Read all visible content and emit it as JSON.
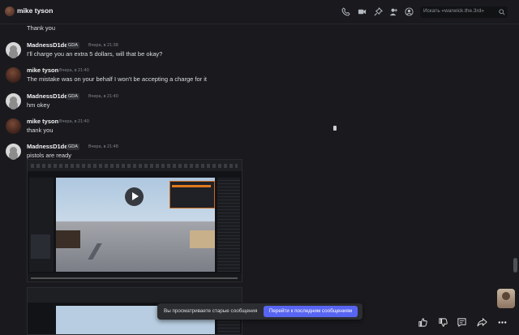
{
  "header": {
    "title": "mike tyson",
    "search_placeholder": "Искать «warwick.the.3rd»"
  },
  "messages": {
    "cont_text": "Thank you",
    "m1": {
      "author": "MadnessD1de",
      "tag": "GDA",
      "time": "Вчера, в 21:38",
      "text": "I'll charge you an extra 5 dollars, will that be okay?"
    },
    "m2": {
      "author": "mike tyson",
      "time": "Вчера, в 21:40",
      "text": "The mistake was on your behalf I won't be accepting a charge for it"
    },
    "m3": {
      "author": "MadnessD1de",
      "tag": "GDA",
      "time": "Вчера, в 21:40",
      "text": "hm okey"
    },
    "m4": {
      "author": "mike tyson",
      "time": "Вчера, в 21:40",
      "text": "thank you"
    },
    "m5": {
      "author": "MadnessD1de",
      "tag": "GDA",
      "time": "Вчера, в 21:48",
      "text": "pistols are ready"
    }
  },
  "banner": {
    "text": "Вы просматриваете старые сообщения",
    "button": "Перейти к последним сообщениям"
  },
  "icons": {
    "header": [
      "phone-icon",
      "video-call-icon",
      "pin-icon",
      "add-friend-icon",
      "profile-icon"
    ],
    "reactions": [
      "thumbs-up-icon",
      "thumbs-down-icon",
      "comment-icon",
      "share-icon",
      "more-icon"
    ]
  },
  "colors": {
    "background": "#1a1a1e",
    "accent": "#5865f2",
    "text": "#dbdee1"
  }
}
